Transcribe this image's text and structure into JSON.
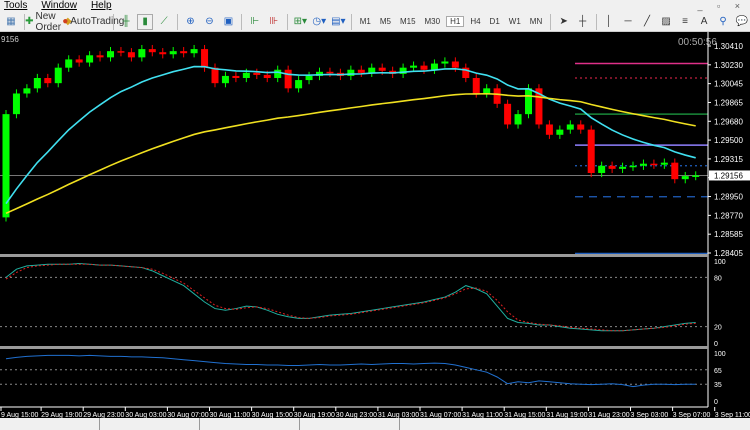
{
  "menu": [
    "Tools",
    "Window",
    "Help"
  ],
  "toolbar": {
    "new_order": "New Order",
    "autotrading": "AutoTrading",
    "timeframes": [
      "M1",
      "M5",
      "M15",
      "M30",
      "H1",
      "H4",
      "D1",
      "W1",
      "MN"
    ],
    "active_timeframe": "H1"
  },
  "chart": {
    "corner_label": "9156",
    "timer": "00:50:56",
    "current_price": "1.29156",
    "price_labels": [
      "1.30410",
      "1.30230",
      "1.30045",
      "1.29865",
      "1.29680",
      "1.29500",
      "1.29315",
      "1.29135",
      "1.28950",
      "1.28770",
      "1.28585",
      "1.28405"
    ],
    "time_labels": [
      "9 Aug 15:00",
      "29 Aug 19:00",
      "29 Aug 23:00",
      "30 Aug 03:00",
      "30 Aug 07:00",
      "30 Aug 11:00",
      "30 Aug 15:00",
      "30 Aug 19:00",
      "30 Aug 23:00",
      "31 Aug 03:00",
      "31 Aug 07:00",
      "31 Aug 11:00",
      "31 Aug 15:00",
      "31 Aug 19:00",
      "31 Aug 23:00",
      "3 Sep 03:00",
      "3 Sep 07:00",
      "3 Sep 11:00"
    ],
    "first_open": 1.2875,
    "closes": [
      1.2975,
      1.2995,
      1.3,
      1.301,
      1.3005,
      1.302,
      1.3028,
      1.3025,
      1.3032,
      1.303,
      1.3036,
      1.3035,
      1.303,
      1.3038,
      1.3035,
      1.3033,
      1.3036,
      1.3034,
      1.3038,
      1.302,
      1.3005,
      1.3012,
      1.301,
      1.3015,
      1.3013,
      1.301,
      1.3018,
      1.3,
      1.3008,
      1.3012,
      1.3016,
      1.3015,
      1.3012,
      1.3018,
      1.3015,
      1.302,
      1.3017,
      1.3014,
      1.302,
      1.3022,
      1.3018,
      1.3024,
      1.3026,
      1.302,
      1.301,
      1.2995,
      1.3,
      1.2985,
      1.2965,
      1.2975,
      1.3,
      1.2965,
      1.2955,
      1.296,
      1.2965,
      1.296,
      1.2918,
      1.2925,
      1.2922,
      1.2924,
      1.2925,
      1.2927,
      1.2926,
      1.2928,
      1.2912,
      1.2915,
      1.29156
    ],
    "hlines": [
      {
        "price": 1.3024,
        "color": "#e0308a",
        "style": "solid"
      },
      {
        "price": 1.301,
        "color": "#c02040",
        "style": "dotted"
      },
      {
        "price": 1.2975,
        "color": "#1a8a3a",
        "style": "solid"
      },
      {
        "price": 1.2945,
        "color": "#9080ff",
        "style": "solid"
      },
      {
        "price": 1.2925,
        "color": "#2060c0",
        "style": "dotted"
      },
      {
        "price": 1.2895,
        "color": "#2060c0",
        "style": "dashed"
      },
      {
        "price": 1.284,
        "color": "#2060c0",
        "style": "solid"
      }
    ],
    "ma_colors": {
      "fast": "#40e0f0",
      "slow": "#f0e020"
    },
    "bull_color": "#00ff00",
    "bear_color": "#ff0000"
  },
  "stoch": {
    "levels": [
      "100",
      "80",
      "20",
      "0"
    ],
    "main": [
      80,
      90,
      94,
      95,
      96,
      96,
      96,
      97,
      96,
      95,
      95,
      94,
      93,
      92,
      88,
      82,
      76,
      70,
      60,
      50,
      42,
      40,
      42,
      45,
      44,
      40,
      35,
      32,
      30,
      30,
      32,
      34,
      35,
      36,
      38,
      40,
      42,
      44,
      46,
      48,
      50,
      53,
      56,
      62,
      70,
      66,
      60,
      45,
      30,
      25,
      24,
      22,
      22,
      20,
      18,
      17,
      16,
      15,
      15,
      15,
      16,
      17,
      18,
      20,
      22,
      24,
      25
    ],
    "signal": [
      78,
      86,
      92,
      94,
      95,
      96,
      96,
      96,
      96,
      95,
      95,
      94,
      93,
      92,
      90,
      85,
      79,
      73,
      64,
      55,
      46,
      42,
      41,
      43,
      44,
      42,
      38,
      34,
      31,
      30,
      31,
      33,
      34,
      35,
      37,
      39,
      41,
      43,
      45,
      47,
      49,
      52,
      55,
      60,
      66,
      67,
      63,
      52,
      38,
      28,
      25,
      23,
      22,
      21,
      19,
      18,
      17,
      16,
      15,
      15,
      16,
      17,
      18,
      19,
      21,
      23,
      24
    ],
    "main_color": "#20b0a0",
    "signal_color": "#e02020"
  },
  "osc2": {
    "levels": [
      "100",
      "65",
      "35",
      "0"
    ],
    "values": [
      88,
      91,
      93,
      94,
      95,
      95,
      95,
      94,
      95,
      94,
      93,
      93,
      92,
      92,
      91,
      90,
      88,
      86,
      84,
      82,
      80,
      78,
      77,
      76,
      76,
      75,
      75,
      74,
      74,
      75,
      76,
      75,
      75,
      76,
      77,
      76,
      77,
      78,
      78,
      77,
      78,
      79,
      78,
      75,
      70,
      65,
      60,
      50,
      36,
      40,
      38,
      42,
      40,
      38,
      36,
      35,
      34,
      35,
      36,
      34,
      30,
      33,
      35,
      35,
      34,
      35,
      35
    ],
    "color": "#2070d0"
  },
  "tabs": [
    "",
    "",
    "",
    ""
  ]
}
